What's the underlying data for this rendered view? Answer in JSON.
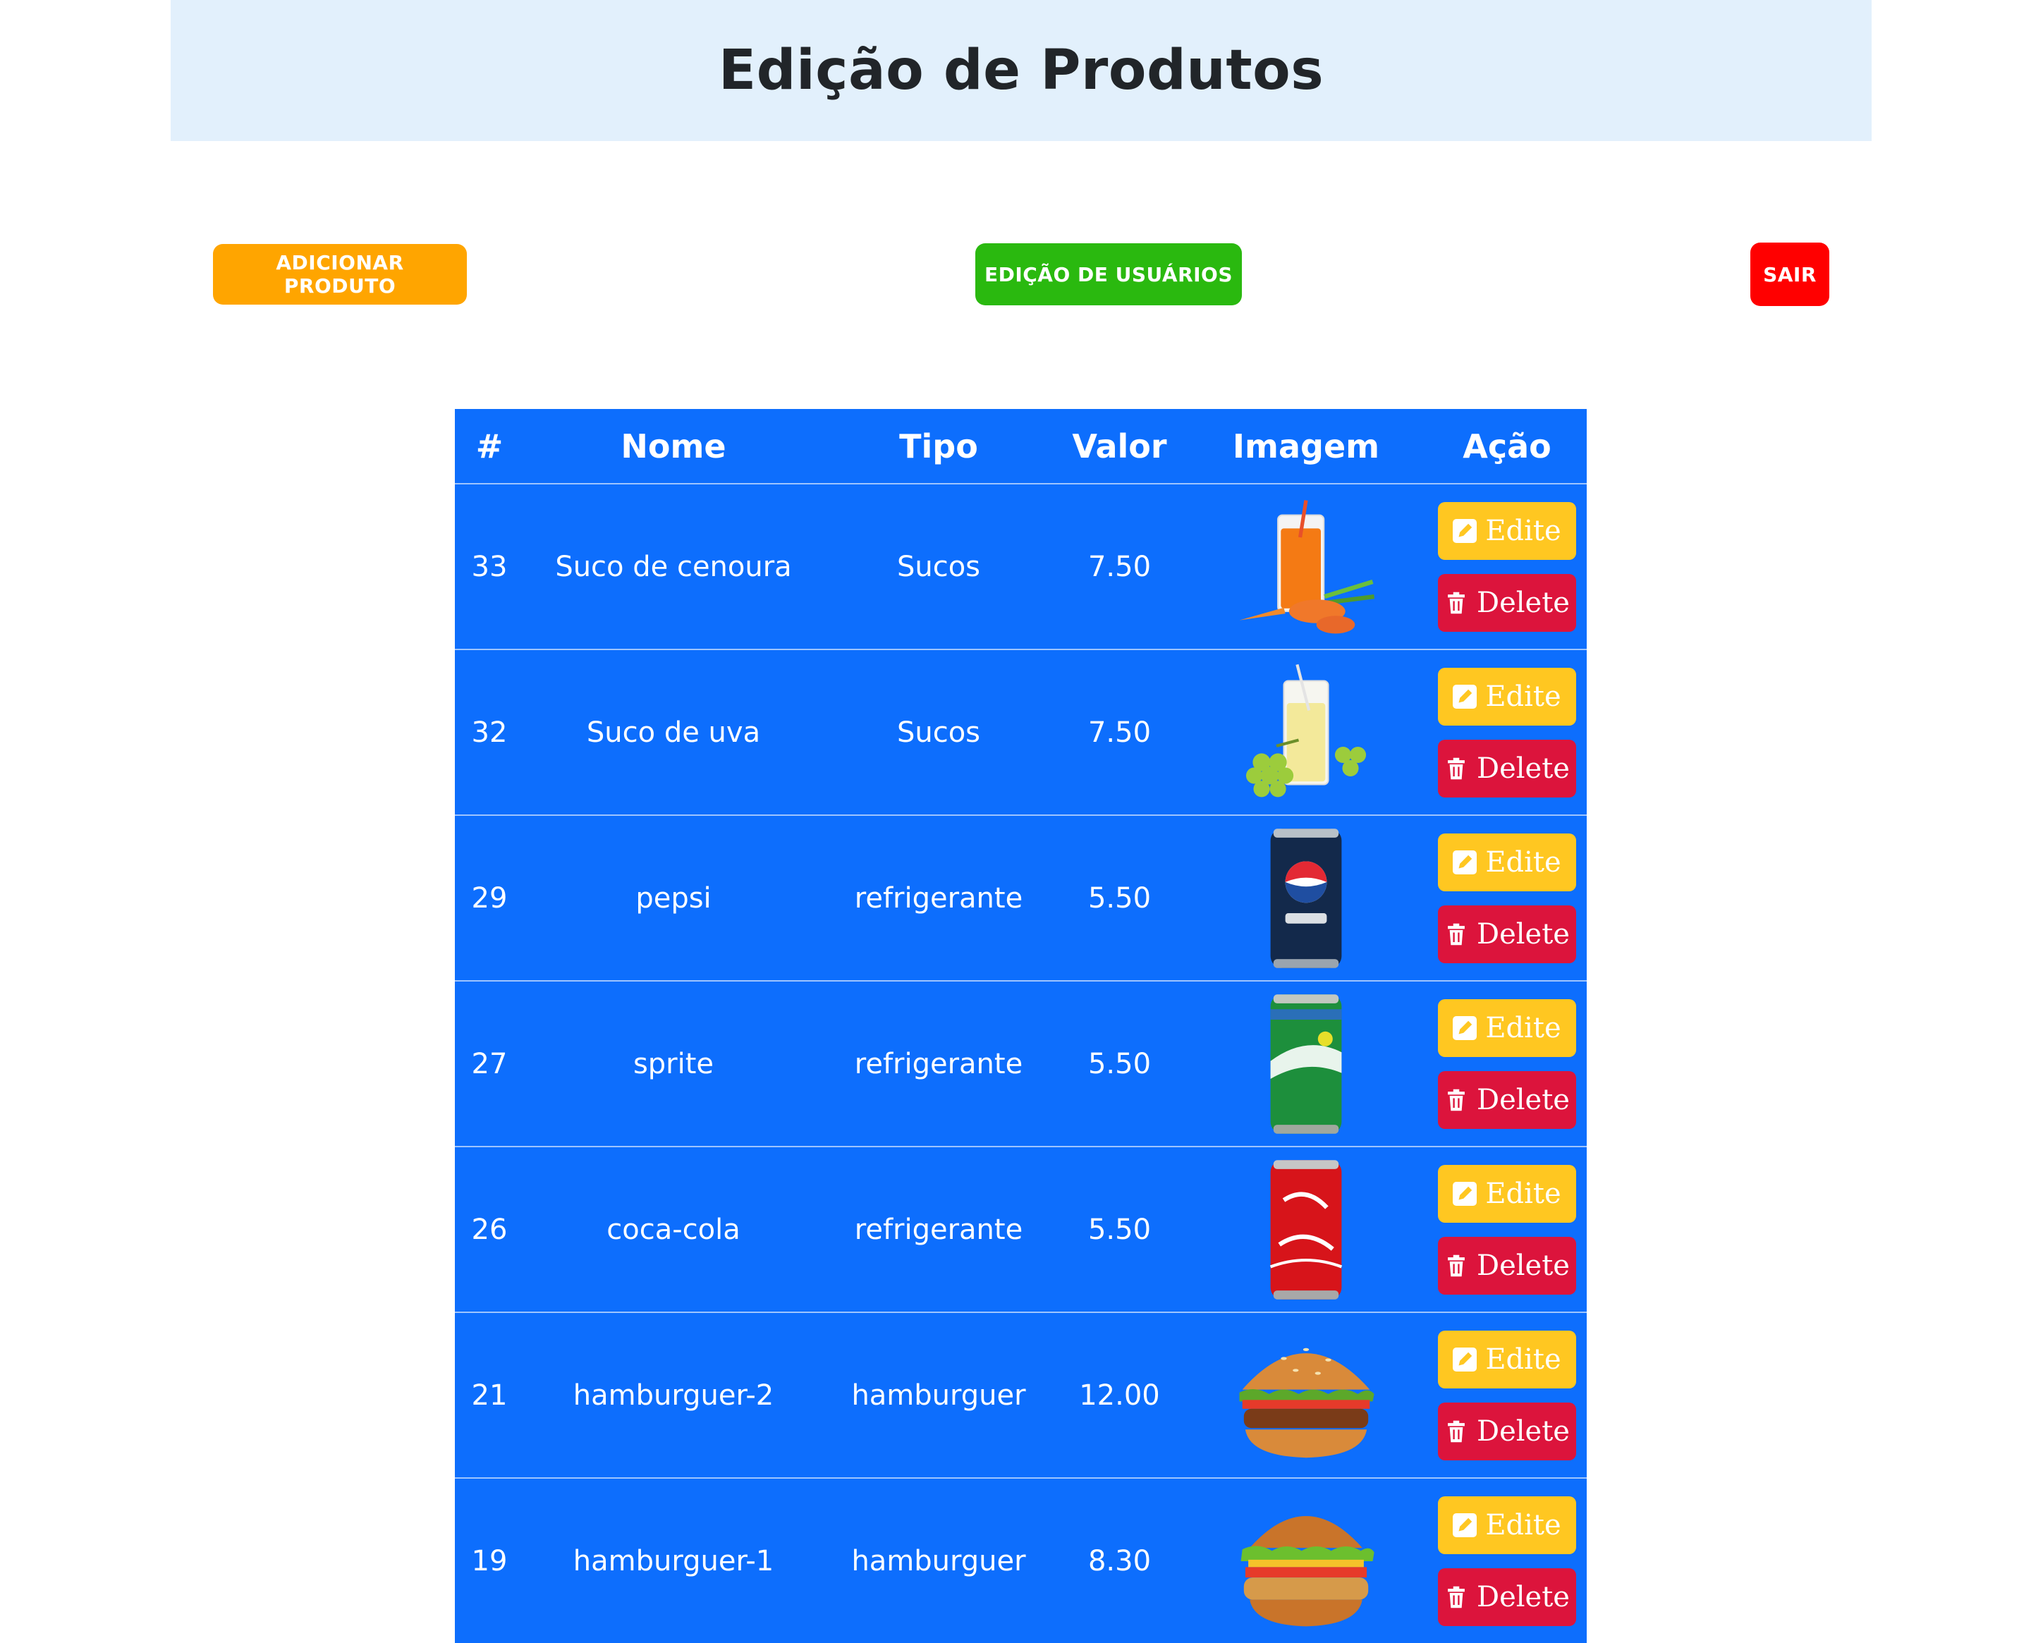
{
  "header": {
    "title": "Edição de Produtos"
  },
  "toolbar": {
    "add_label": "ADICIONAR PRODUTO",
    "users_label": "EDIÇÃO DE USUÁRIOS",
    "exit_label": "SAIR"
  },
  "table": {
    "headers": [
      "#",
      "Nome",
      "Tipo",
      "Valor",
      "Imagem",
      "Ação"
    ],
    "edit_label": "Edite",
    "delete_label": "Delete",
    "rows": [
      {
        "id": "33",
        "nome": "Suco de cenoura",
        "tipo": "Sucos",
        "valor": "7.50",
        "image": "carrot-juice"
      },
      {
        "id": "32",
        "nome": "Suco de uva",
        "tipo": "Sucos",
        "valor": "7.50",
        "image": "grape-juice"
      },
      {
        "id": "29",
        "nome": "pepsi",
        "tipo": "refrigerante",
        "valor": "5.50",
        "image": "pepsi-can"
      },
      {
        "id": "27",
        "nome": "sprite",
        "tipo": "refrigerante",
        "valor": "5.50",
        "image": "sprite-can"
      },
      {
        "id": "26",
        "nome": "coca-cola",
        "tipo": "refrigerante",
        "valor": "5.50",
        "image": "coca-cola-can"
      },
      {
        "id": "21",
        "nome": "hamburguer-2",
        "tipo": "hamburguer",
        "valor": "12.00",
        "image": "hamburger"
      },
      {
        "id": "19",
        "nome": "hamburguer-1",
        "tipo": "hamburguer",
        "valor": "8.30",
        "image": "chicken-burger"
      }
    ]
  },
  "colors": {
    "header_bg": "#e2f0fc",
    "add_button": "#ffa500",
    "users_button": "#2ab90f",
    "exit_button": "#ff0000",
    "table_bg": "#0d6efd",
    "edit_button": "#ffc721",
    "delete_button": "#dc143c"
  }
}
